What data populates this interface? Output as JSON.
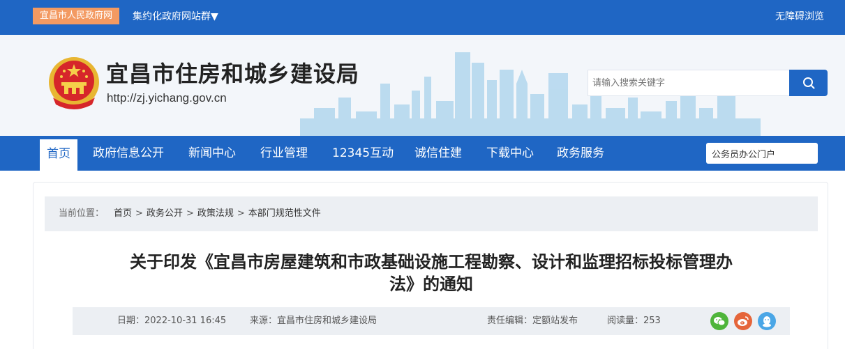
{
  "topbar": {
    "home_link": "宜昌市人民政府网",
    "sites_menu": "集约化政府网站群▼",
    "accessibility": "无障碍浏览"
  },
  "header": {
    "title": "宜昌市住房和城乡建设局",
    "url": "http://zj.yichang.gov.cn",
    "search_placeholder": "请输入搜索关键字"
  },
  "nav": {
    "items": [
      "首页",
      "政府信息公开",
      "新闻中心",
      "行业管理",
      "12345互动",
      "诚信住建",
      "下载中心",
      "政务服务"
    ],
    "portal_value": "公务员办公门户"
  },
  "breadcrumb": {
    "label": "当前位置：",
    "items": [
      "首页",
      "政务公开",
      "政策法规",
      "本部门规范性文件"
    ],
    "separator": ">"
  },
  "article": {
    "title_line1": "关于印发《宜昌市房屋建筑和市政基础设施工程勘察、设计和监理招标投标管理办",
    "title_line2": "法》的通知",
    "date": "日期：2022-10-31 16:45",
    "source": "来源：宜昌市住房和城乡建设局",
    "editor": "责任编辑：定额站发布",
    "views": "阅读量：253"
  },
  "colors": {
    "primary": "#1f66c4",
    "accent_orange": "#f39a62",
    "wechat": "#4fb53b",
    "weibo": "#e5653a",
    "qq": "#4aa6e6"
  },
  "icons": [
    "search-icon",
    "national-emblem",
    "wechat-icon",
    "weibo-icon",
    "qq-icon"
  ]
}
